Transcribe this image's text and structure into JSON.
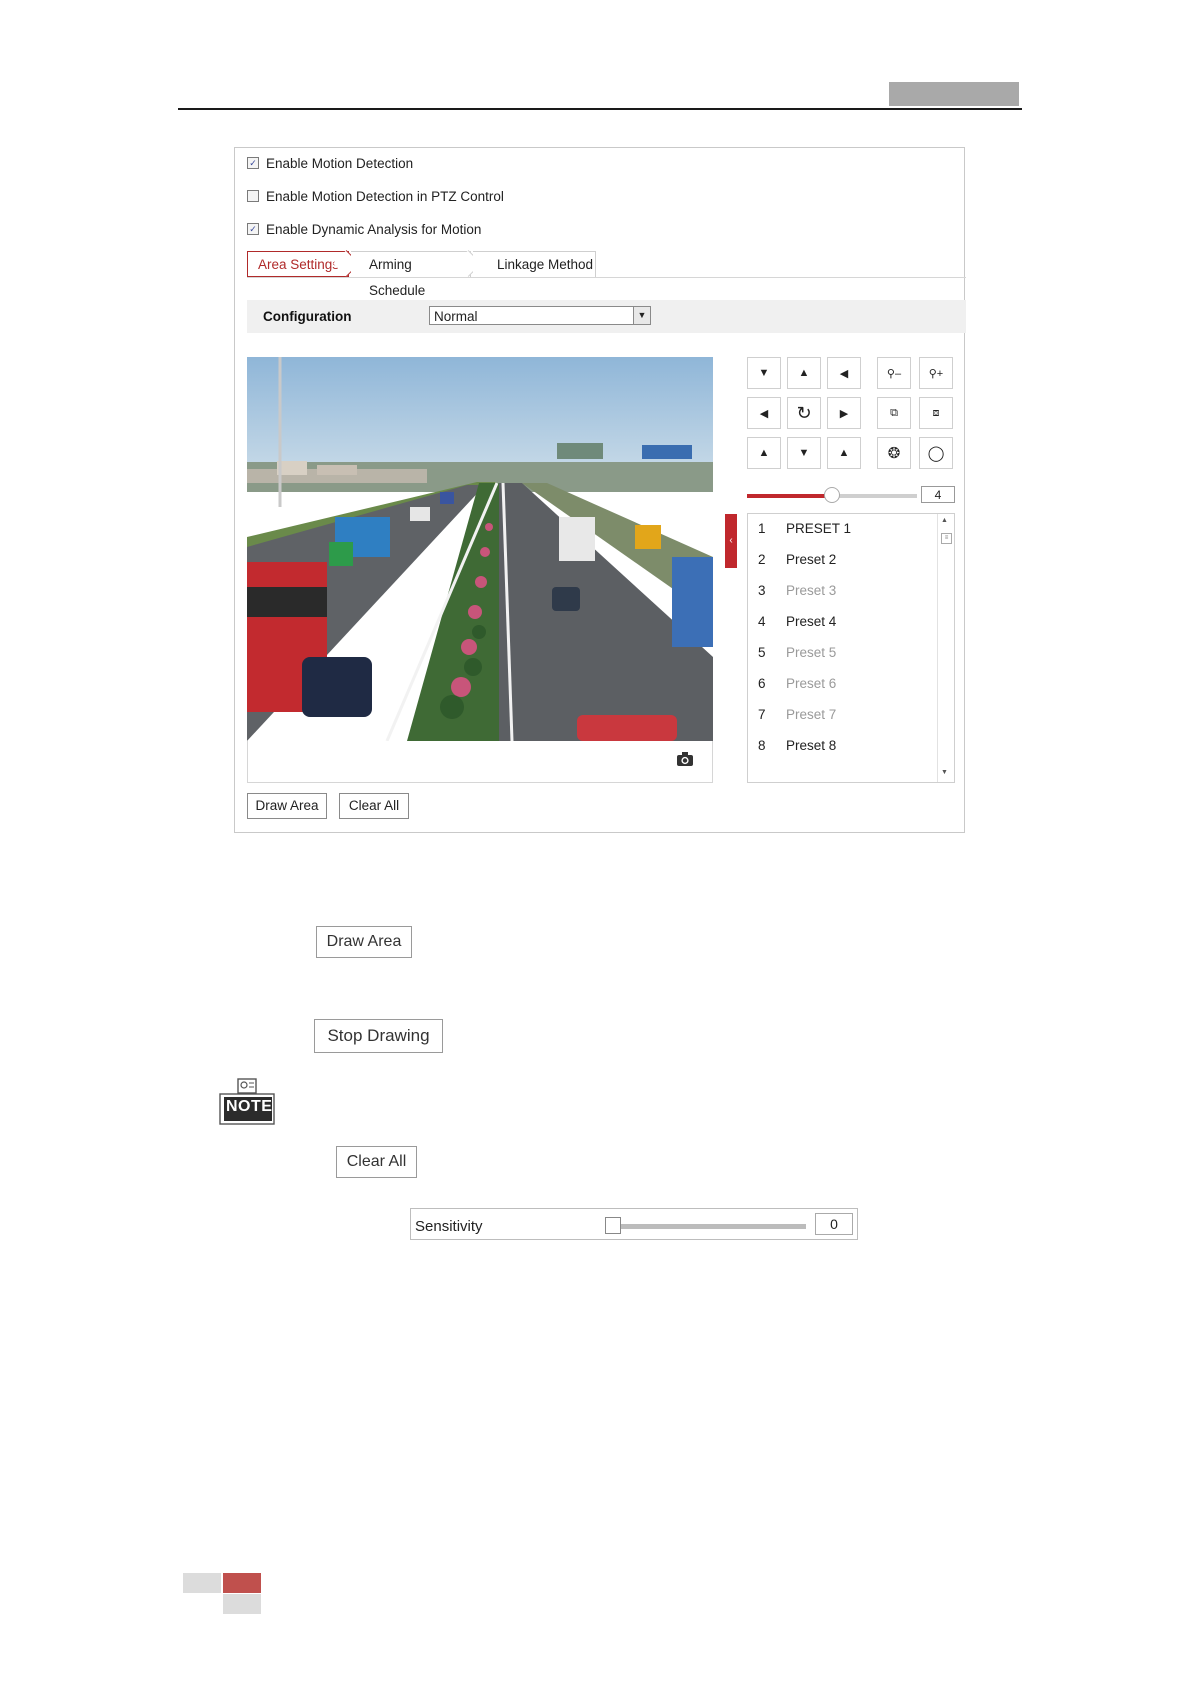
{
  "options": {
    "enable_motion_detection": {
      "label": "Enable Motion Detection",
      "checked": true
    },
    "enable_motion_ptz": {
      "label": "Enable Motion Detection in PTZ Control",
      "checked": false
    },
    "enable_dynamic_analysis": {
      "label": "Enable Dynamic Analysis for Motion",
      "checked": true
    }
  },
  "tabs": [
    {
      "label": "Area Settings",
      "active": true
    },
    {
      "label": "Arming Schedule",
      "active": false
    },
    {
      "label": "Linkage Method",
      "active": false
    }
  ],
  "configuration": {
    "label": "Configuration",
    "value": "Normal"
  },
  "ptz": {
    "speed_value": "4",
    "speed_fraction": 0.5
  },
  "presets": [
    {
      "num": "1",
      "name": "PRESET 1",
      "set": true
    },
    {
      "num": "2",
      "name": "Preset 2",
      "set": true
    },
    {
      "num": "3",
      "name": "Preset 3",
      "set": false
    },
    {
      "num": "4",
      "name": "Preset 4",
      "set": true
    },
    {
      "num": "5",
      "name": "Preset 5",
      "set": false
    },
    {
      "num": "6",
      "name": "Preset 6",
      "set": false
    },
    {
      "num": "7",
      "name": "Preset 7",
      "set": false
    },
    {
      "num": "8",
      "name": "Preset 8",
      "set": true
    }
  ],
  "panel_buttons": {
    "draw_area": "Draw Area",
    "clear_all": "Clear All"
  },
  "doc_buttons": {
    "draw_area": "Draw Area",
    "stop_drawing": "Stop Drawing",
    "clear_all": "Clear All"
  },
  "note_label": "NOTE",
  "sensitivity": {
    "label": "Sensitivity",
    "value": "0"
  },
  "colors": {
    "accent": "#c0282d",
    "header_block": "#a9a9a9",
    "footer_red": "#c0504d"
  }
}
